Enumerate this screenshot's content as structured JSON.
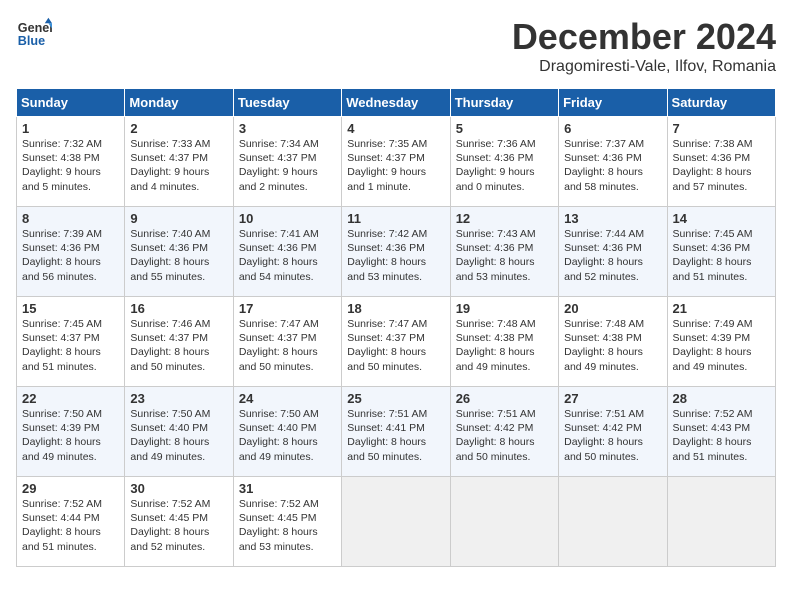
{
  "logo": {
    "line1": "General",
    "line2": "Blue"
  },
  "title": "December 2024",
  "subtitle": "Dragomiresti-Vale, Ilfov, Romania",
  "days_of_week": [
    "Sunday",
    "Monday",
    "Tuesday",
    "Wednesday",
    "Thursday",
    "Friday",
    "Saturday"
  ],
  "weeks": [
    [
      {
        "day": "1",
        "sunrise": "7:32 AM",
        "sunset": "4:38 PM",
        "daylight": "9 hours and 5 minutes."
      },
      {
        "day": "2",
        "sunrise": "7:33 AM",
        "sunset": "4:37 PM",
        "daylight": "9 hours and 4 minutes."
      },
      {
        "day": "3",
        "sunrise": "7:34 AM",
        "sunset": "4:37 PM",
        "daylight": "9 hours and 2 minutes."
      },
      {
        "day": "4",
        "sunrise": "7:35 AM",
        "sunset": "4:37 PM",
        "daylight": "9 hours and 1 minute."
      },
      {
        "day": "5",
        "sunrise": "7:36 AM",
        "sunset": "4:36 PM",
        "daylight": "9 hours and 0 minutes."
      },
      {
        "day": "6",
        "sunrise": "7:37 AM",
        "sunset": "4:36 PM",
        "daylight": "8 hours and 58 minutes."
      },
      {
        "day": "7",
        "sunrise": "7:38 AM",
        "sunset": "4:36 PM",
        "daylight": "8 hours and 57 minutes."
      }
    ],
    [
      {
        "day": "8",
        "sunrise": "7:39 AM",
        "sunset": "4:36 PM",
        "daylight": "8 hours and 56 minutes."
      },
      {
        "day": "9",
        "sunrise": "7:40 AM",
        "sunset": "4:36 PM",
        "daylight": "8 hours and 55 minutes."
      },
      {
        "day": "10",
        "sunrise": "7:41 AM",
        "sunset": "4:36 PM",
        "daylight": "8 hours and 54 minutes."
      },
      {
        "day": "11",
        "sunrise": "7:42 AM",
        "sunset": "4:36 PM",
        "daylight": "8 hours and 53 minutes."
      },
      {
        "day": "12",
        "sunrise": "7:43 AM",
        "sunset": "4:36 PM",
        "daylight": "8 hours and 53 minutes."
      },
      {
        "day": "13",
        "sunrise": "7:44 AM",
        "sunset": "4:36 PM",
        "daylight": "8 hours and 52 minutes."
      },
      {
        "day": "14",
        "sunrise": "7:45 AM",
        "sunset": "4:36 PM",
        "daylight": "8 hours and 51 minutes."
      }
    ],
    [
      {
        "day": "15",
        "sunrise": "7:45 AM",
        "sunset": "4:37 PM",
        "daylight": "8 hours and 51 minutes."
      },
      {
        "day": "16",
        "sunrise": "7:46 AM",
        "sunset": "4:37 PM",
        "daylight": "8 hours and 50 minutes."
      },
      {
        "day": "17",
        "sunrise": "7:47 AM",
        "sunset": "4:37 PM",
        "daylight": "8 hours and 50 minutes."
      },
      {
        "day": "18",
        "sunrise": "7:47 AM",
        "sunset": "4:37 PM",
        "daylight": "8 hours and 50 minutes."
      },
      {
        "day": "19",
        "sunrise": "7:48 AM",
        "sunset": "4:38 PM",
        "daylight": "8 hours and 49 minutes."
      },
      {
        "day": "20",
        "sunrise": "7:48 AM",
        "sunset": "4:38 PM",
        "daylight": "8 hours and 49 minutes."
      },
      {
        "day": "21",
        "sunrise": "7:49 AM",
        "sunset": "4:39 PM",
        "daylight": "8 hours and 49 minutes."
      }
    ],
    [
      {
        "day": "22",
        "sunrise": "7:50 AM",
        "sunset": "4:39 PM",
        "daylight": "8 hours and 49 minutes."
      },
      {
        "day": "23",
        "sunrise": "7:50 AM",
        "sunset": "4:40 PM",
        "daylight": "8 hours and 49 minutes."
      },
      {
        "day": "24",
        "sunrise": "7:50 AM",
        "sunset": "4:40 PM",
        "daylight": "8 hours and 49 minutes."
      },
      {
        "day": "25",
        "sunrise": "7:51 AM",
        "sunset": "4:41 PM",
        "daylight": "8 hours and 50 minutes."
      },
      {
        "day": "26",
        "sunrise": "7:51 AM",
        "sunset": "4:42 PM",
        "daylight": "8 hours and 50 minutes."
      },
      {
        "day": "27",
        "sunrise": "7:51 AM",
        "sunset": "4:42 PM",
        "daylight": "8 hours and 50 minutes."
      },
      {
        "day": "28",
        "sunrise": "7:52 AM",
        "sunset": "4:43 PM",
        "daylight": "8 hours and 51 minutes."
      }
    ],
    [
      {
        "day": "29",
        "sunrise": "7:52 AM",
        "sunset": "4:44 PM",
        "daylight": "8 hours and 51 minutes."
      },
      {
        "day": "30",
        "sunrise": "7:52 AM",
        "sunset": "4:45 PM",
        "daylight": "8 hours and 52 minutes."
      },
      {
        "day": "31",
        "sunrise": "7:52 AM",
        "sunset": "4:45 PM",
        "daylight": "8 hours and 53 minutes."
      },
      null,
      null,
      null,
      null
    ]
  ]
}
